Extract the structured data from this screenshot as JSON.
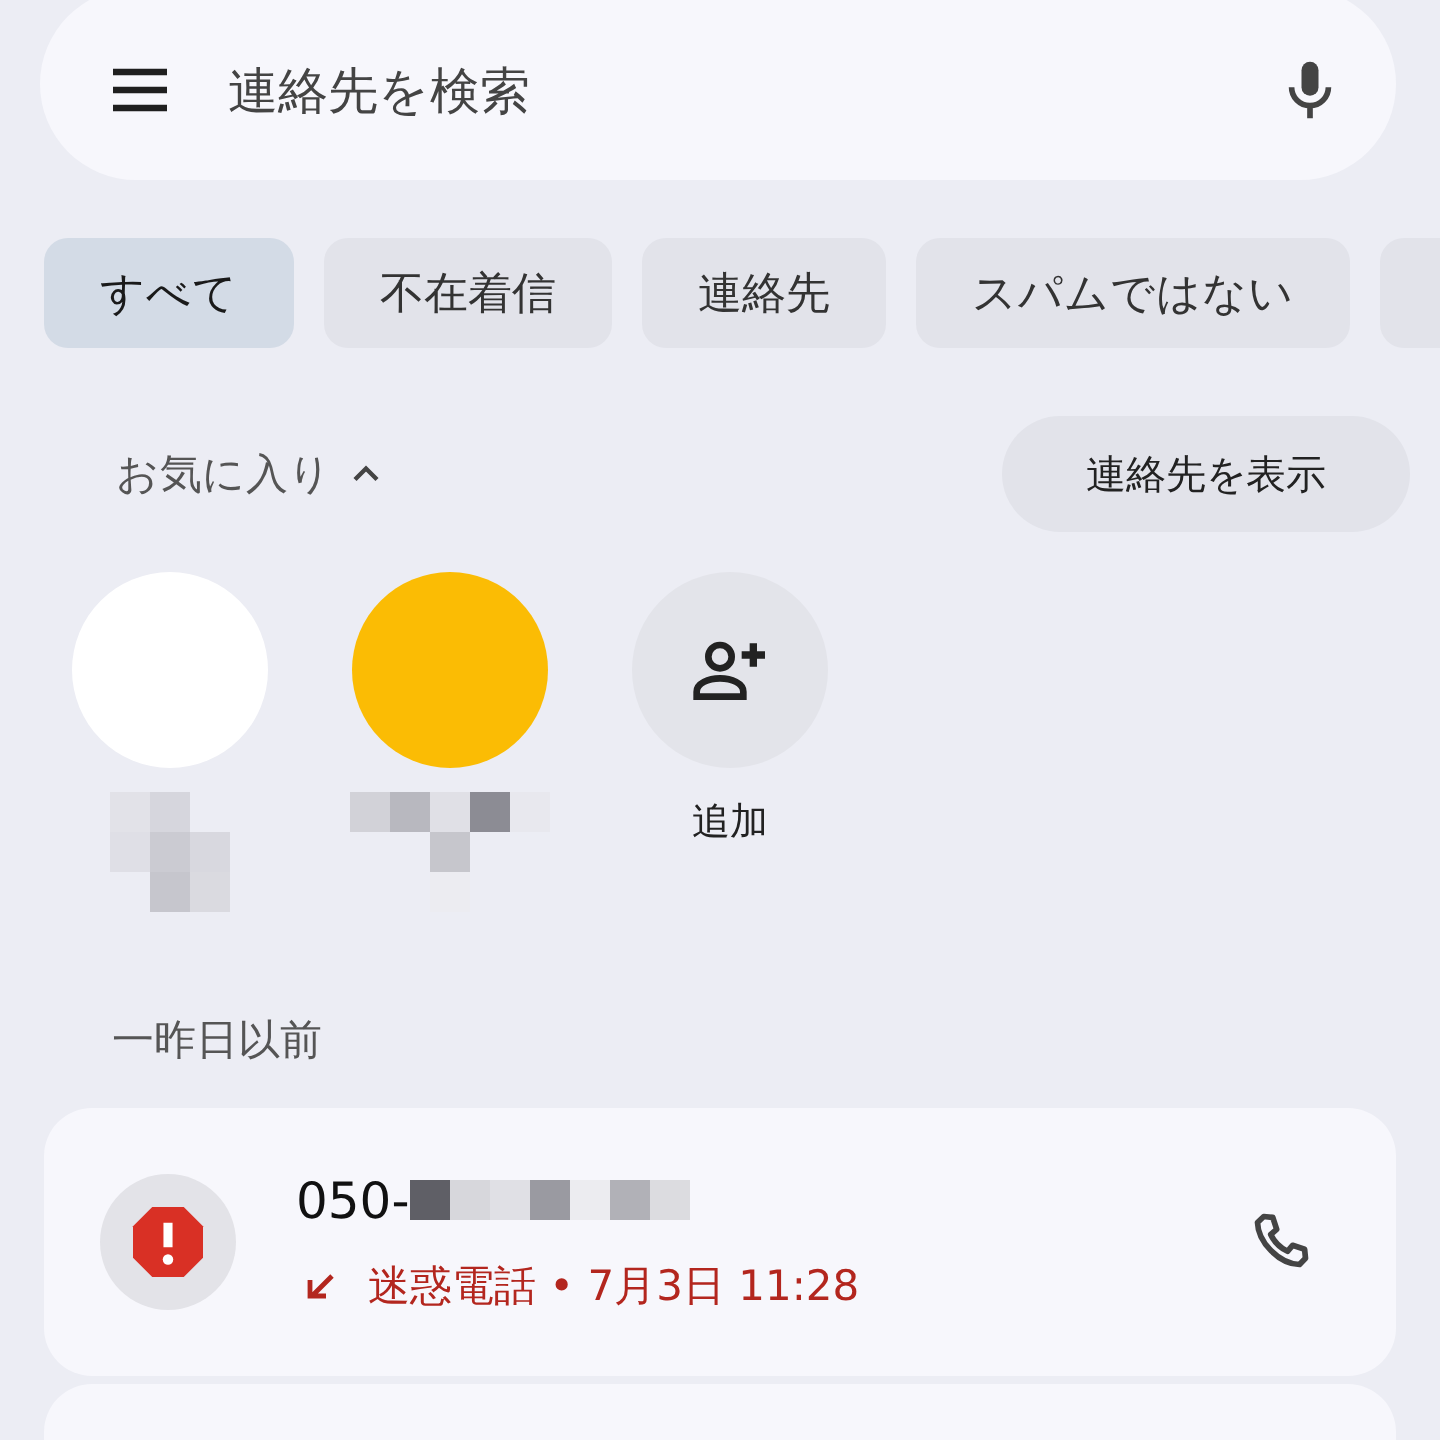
{
  "search": {
    "placeholder": "連絡先を検索"
  },
  "filters": [
    {
      "label": "すべて",
      "selected": true
    },
    {
      "label": "不在着信",
      "selected": false
    },
    {
      "label": "連絡先",
      "selected": false
    },
    {
      "label": "スパムではない",
      "selected": false
    },
    {
      "selected": false
    }
  ],
  "favorites": {
    "title": "お気に入り",
    "expanded": true,
    "show_contacts_button": "連絡先を表示",
    "items": [
      {
        "kind": "contact",
        "color": "#ffffff"
      },
      {
        "kind": "contact",
        "color": "#fbbc04"
      },
      {
        "kind": "add",
        "label": "追加"
      }
    ]
  },
  "sections": [
    {
      "title": "一昨日以前",
      "calls": [
        {
          "number": "050-",
          "spam": true,
          "detail": "迷惑電話 • 7月3日 11:28"
        }
      ]
    }
  ]
}
